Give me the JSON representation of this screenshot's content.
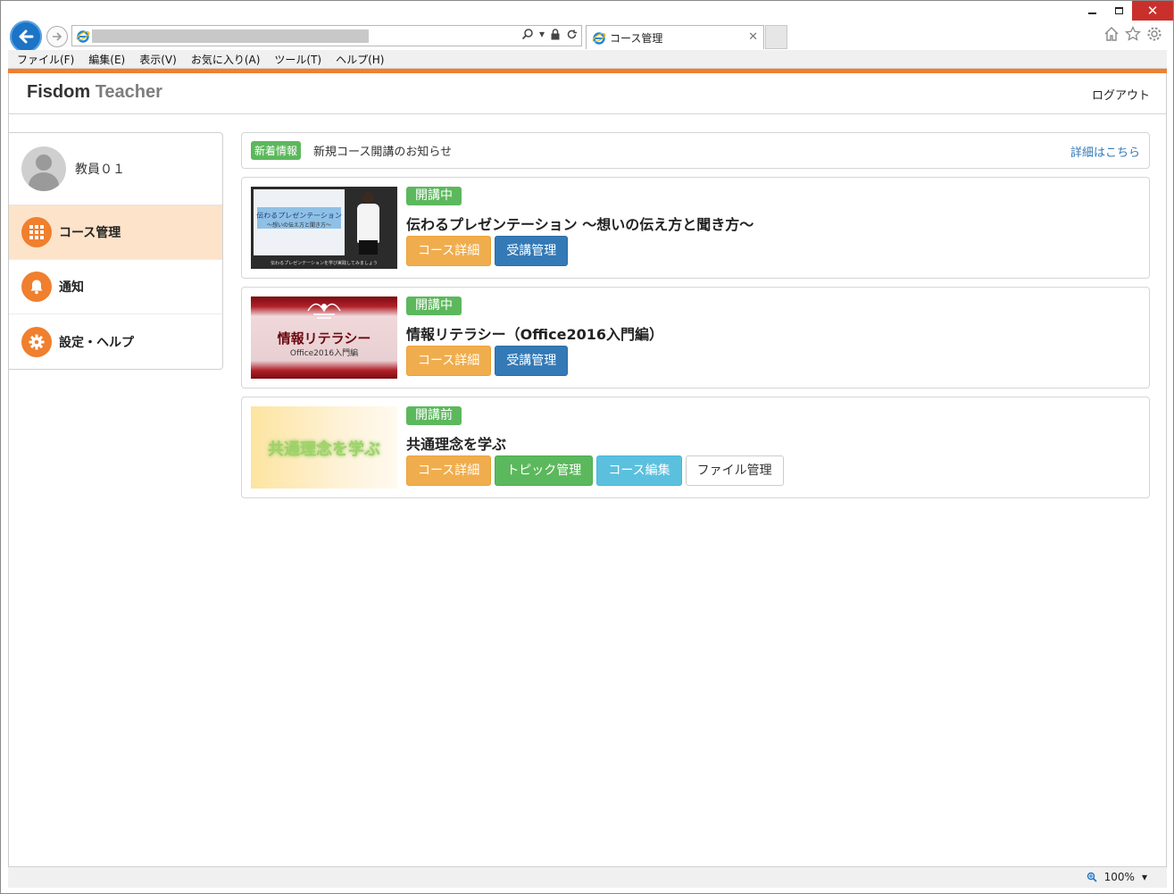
{
  "browser": {
    "tab_title": "コース管理",
    "menu": [
      "ファイル(F)",
      "編集(E)",
      "表示(V)",
      "お気に入り(A)",
      "ツール(T)",
      "ヘルプ(H)"
    ],
    "zoom": "100%",
    "icons": [
      "back-icon",
      "forward-icon",
      "ie-logo-icon",
      "search-icon",
      "lock-icon",
      "refresh-icon",
      "home-icon",
      "star-icon",
      "gear-icon"
    ]
  },
  "header": {
    "brand_part1": "Fisdom",
    "brand_part2": "Teacher",
    "logout": "ログアウト"
  },
  "sidebar": {
    "user_name": "教員０１",
    "items": [
      {
        "label": "コース管理",
        "icon": "grid-icon",
        "active": true
      },
      {
        "label": "通知",
        "icon": "bell-icon",
        "active": false
      },
      {
        "label": "設定・ヘルプ",
        "icon": "gear-icon",
        "active": false
      }
    ]
  },
  "notice": {
    "badge": "新着情報",
    "text": "新規コース開講のお知らせ",
    "link": "詳細はこちら"
  },
  "courses": [
    {
      "status": "開講中",
      "title": "伝わるプレゼンテーション ～想いの伝え方と聞き方～",
      "thumb_title": "伝わるプレゼンテーション",
      "thumb_sub": "～想いの伝え方と聞き方～",
      "thumb_caption": "伝わるプレゼンテーションを学び実践してみましょう",
      "buttons": [
        "コース詳細",
        "受講管理"
      ]
    },
    {
      "status": "開講中",
      "title": "情報リテラシー（Office2016入門編）",
      "thumb_title": "情報リテラシー",
      "thumb_sub": "Office2016入門編",
      "buttons": [
        "コース詳細",
        "受講管理"
      ]
    },
    {
      "status": "開講前",
      "title": "共通理念を学ぶ",
      "thumb_title": "共通理念を学ぶ",
      "buttons": [
        "コース詳細",
        "トピック管理",
        "コース編集",
        "ファイル管理"
      ]
    }
  ],
  "colors": {
    "accent": "#f07f2e",
    "active_bg": "#fde3c9",
    "success": "#5cb85c",
    "warning": "#f0ad4e",
    "primary": "#337ab7",
    "info": "#5bc0de",
    "link": "#337ab7"
  }
}
